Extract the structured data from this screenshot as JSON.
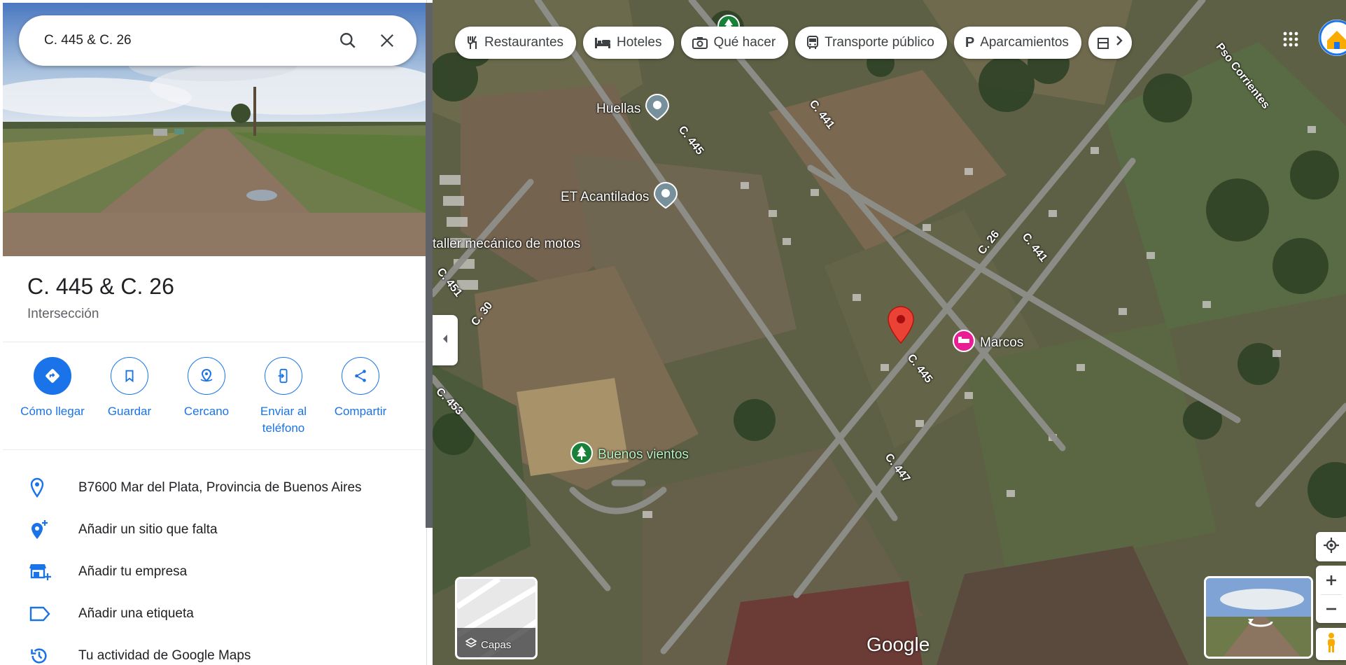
{
  "search": {
    "query": "C. 445 & C. 26"
  },
  "place": {
    "title": "C. 445 & C. 26",
    "subtitle": "Intersección"
  },
  "actions": [
    {
      "label": "Cómo llegar"
    },
    {
      "label": "Guardar"
    },
    {
      "label": "Cercano"
    },
    {
      "label": "Enviar al teléfono"
    },
    {
      "label": "Compartir"
    }
  ],
  "info": [
    {
      "text": "B7600 Mar del Plata, Provincia de Buenos Aires"
    },
    {
      "text": "Añadir un sitio que falta"
    },
    {
      "text": "Añadir tu empresa"
    },
    {
      "text": "Añadir una etiqueta"
    },
    {
      "text": "Tu actividad de Google Maps"
    }
  ],
  "chips": [
    {
      "label": "Restaurantes"
    },
    {
      "label": "Hoteles"
    },
    {
      "label": "Qué hacer"
    },
    {
      "label": "Transporte público"
    },
    {
      "label": "Aparcamientos"
    }
  ],
  "map": {
    "pois": {
      "huellas": "Huellas",
      "et": "ET Acantilados",
      "taller": "taller mecánico de motos",
      "marcos": "Marcos",
      "buenos": "Buenos vientos"
    },
    "streets": {
      "s445a": "C. 445",
      "s445b": "C. 445",
      "s441a": "C. 441",
      "s441b": "C. 441",
      "s26": "C. 26",
      "s451": "C. 451",
      "s30": "C. 30",
      "s453": "C. 453",
      "s447": "C. 447",
      "corrientes": "Pso Corrientes"
    },
    "layers_label": "Capas",
    "logo": "Google"
  },
  "colors": {
    "accent": "#1a73e8",
    "pin": "#ea4335",
    "poi_grey": "#78909c",
    "poi_green": "#188038",
    "poi_pink": "#e91e93"
  }
}
